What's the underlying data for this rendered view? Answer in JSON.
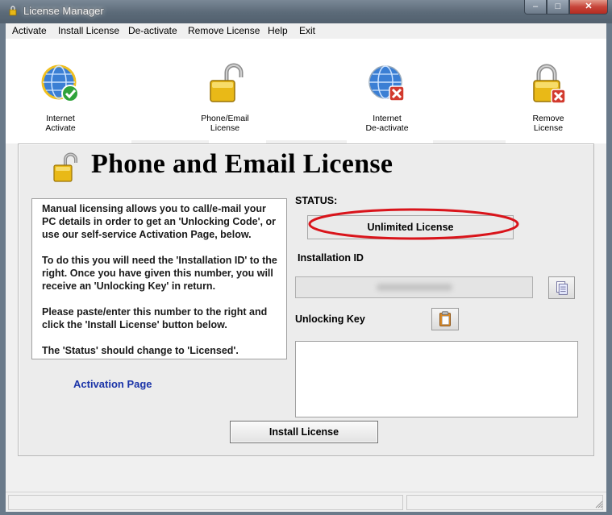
{
  "window": {
    "title": "License Manager",
    "controls": [
      "–",
      "□",
      "✕"
    ]
  },
  "menu": [
    "Activate",
    "Install License",
    "De-activate",
    "Remove License",
    "Help",
    "Exit"
  ],
  "toolbar": [
    {
      "label": "Internet\nActivate",
      "icon": "globe-check-icon"
    },
    {
      "label": "Phone/Email\nLicense",
      "icon": "padlock-open-icon"
    },
    {
      "label": "Internet\nDe-activate",
      "icon": "globe-x-icon"
    },
    {
      "label": "Remove\nLicense",
      "icon": "padlock-x-icon"
    }
  ],
  "panel": {
    "title": "Phone and Email License",
    "info": [
      "Manual licensing allows you to call/e-mail your PC details in order to get an 'Unlocking Code', or use our self-service Activation Page, below.",
      "To do this you will need the 'Installation ID' to the right.  Once you have given this number, you will receive an 'Unlocking Key' in return.",
      "Please paste/enter this number to the right and click the 'Install License' button below.",
      "The 'Status' should change to 'Licensed'."
    ],
    "activation_link": "Activation Page",
    "status_label": "STATUS:",
    "status_value": "Unlimited License",
    "installation_id_label": "Installation ID",
    "unlocking_key_label": "Unlocking Key",
    "install_button": "Install License"
  },
  "colors": {
    "link": "#1b34a8",
    "highlight_ellipse": "#d9141b",
    "lock_gold": "#e8b818"
  }
}
